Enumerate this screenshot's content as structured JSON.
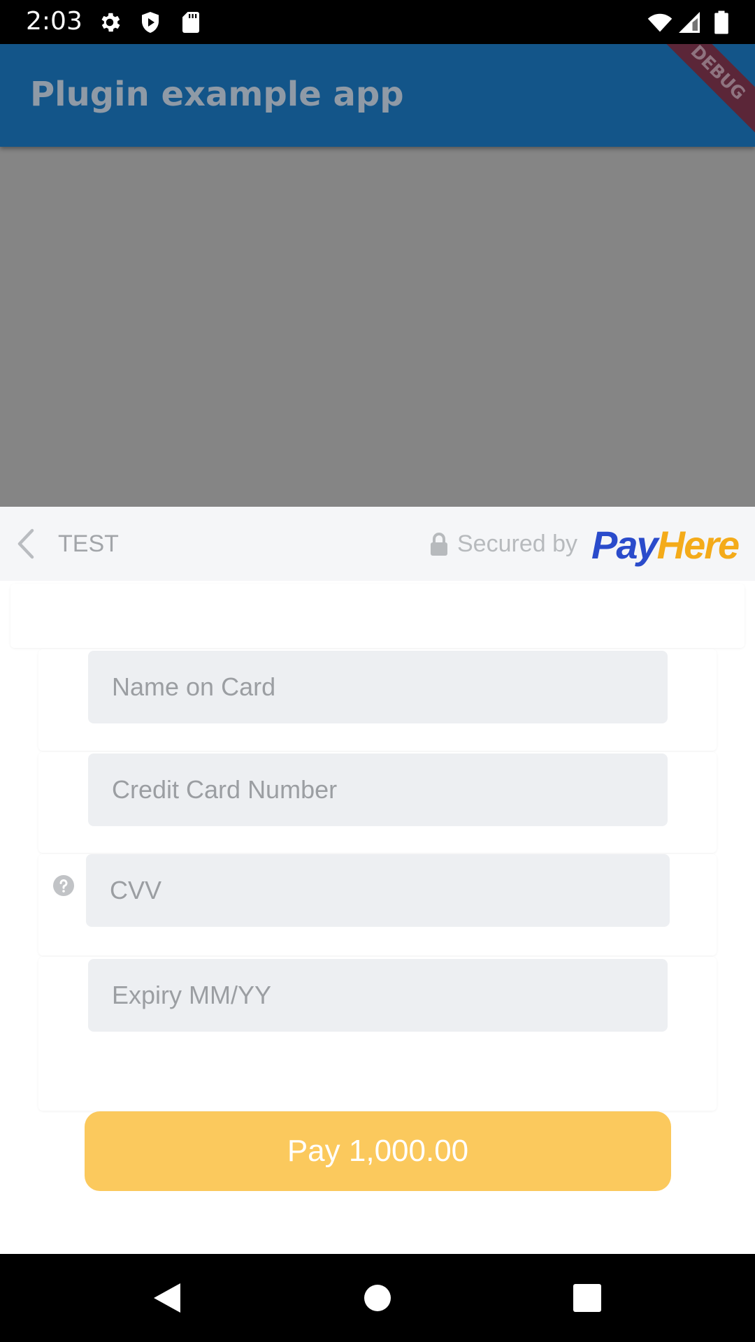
{
  "status_bar": {
    "time": "2:03",
    "left_icons": [
      "gear-icon",
      "shield-icon",
      "sd-card-icon"
    ],
    "right_icons": [
      "wifi-icon",
      "signal-icon",
      "battery-icon"
    ]
  },
  "app_bar": {
    "title": "Plugin example app",
    "debug_banner": "DEBUG",
    "color": "#135589"
  },
  "payment_sheet": {
    "merchant": "TEST",
    "secured_label": "Secured by",
    "brand_pay": "Pay",
    "brand_here": "Here",
    "brand_colors": {
      "pay": "#2a4bcb",
      "here": "#f4ab1a"
    },
    "fields": {
      "name_placeholder": "Name on Card",
      "card_number_placeholder": "Credit Card Number",
      "cvv_placeholder": "CVV",
      "expiry_placeholder": "Expiry MM/YY"
    },
    "pay_button": "Pay 1,000.00",
    "pay_button_color": "#fbc95d"
  },
  "nav_bar": {
    "icons": [
      "back-triangle-icon",
      "home-circle-icon",
      "recents-square-icon"
    ]
  }
}
